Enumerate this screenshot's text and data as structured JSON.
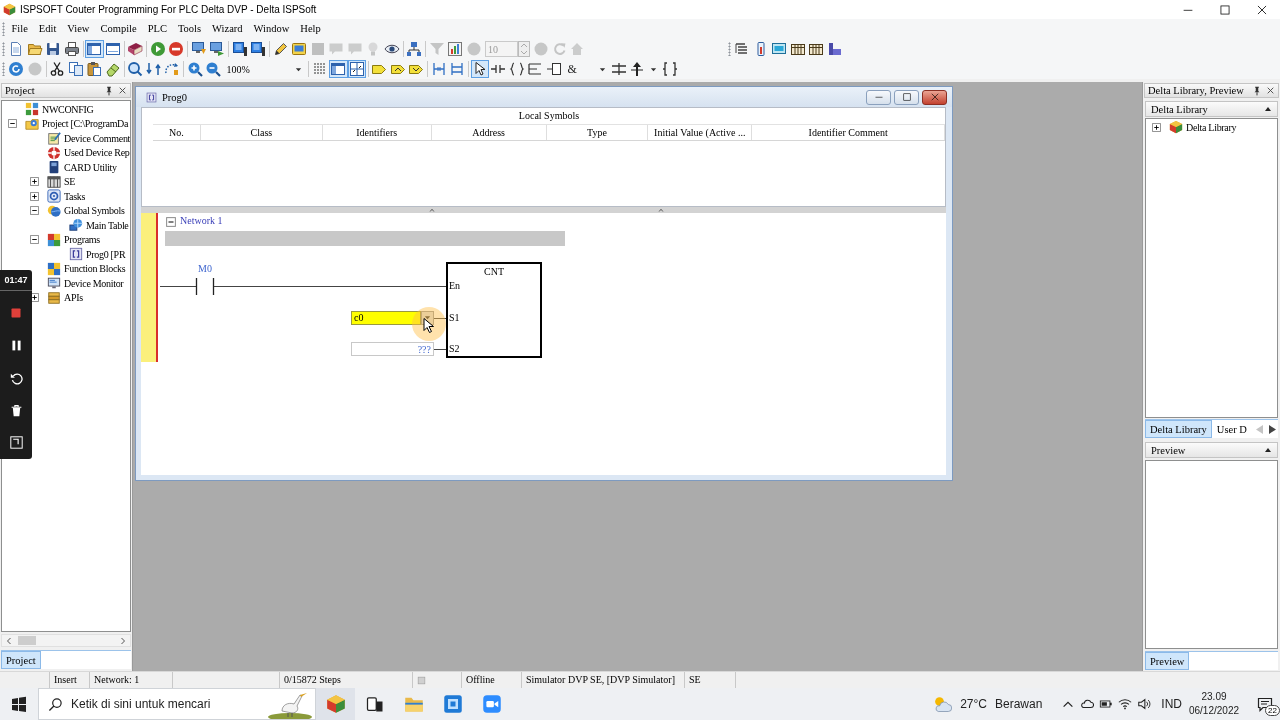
{
  "window": {
    "title": "ISPSOFT Couter Programming For PLC Delta DVP - Delta ISPSoft"
  },
  "menu": [
    "File",
    "Edit",
    "View",
    "Compile",
    "PLC",
    "Tools",
    "Wizard",
    "Window",
    "Help"
  ],
  "toolbar_rows": [
    {
      "toolbars": [
        {
          "items": [
            {
              "kind": "button",
              "disabled": false,
              "pressed": false
            },
            {
              "kind": "button",
              "disabled": false,
              "pressed": false
            },
            {
              "kind": "button",
              "disabled": false,
              "pressed": false
            },
            {
              "kind": "button",
              "disabled": false,
              "pressed": false
            },
            {
              "kind": "separator"
            },
            {
              "kind": "button",
              "disabled": false,
              "pressed": true
            },
            {
              "kind": "button",
              "disabled": false,
              "pressed": false
            },
            {
              "kind": "separator"
            },
            {
              "kind": "button",
              "disabled": false,
              "pressed": false
            },
            {
              "kind": "separator"
            },
            {
              "kind": "button",
              "disabled": false,
              "pressed": false
            },
            {
              "kind": "button",
              "disabled": false,
              "pressed": false
            },
            {
              "kind": "separator"
            },
            {
              "kind": "button",
              "disabled": false,
              "pressed": false
            },
            {
              "kind": "button",
              "disabled": false,
              "pressed": false
            },
            {
              "kind": "separator"
            },
            {
              "kind": "button",
              "disabled": false,
              "pressed": false
            },
            {
              "kind": "button",
              "disabled": false,
              "pressed": false
            },
            {
              "kind": "separator"
            },
            {
              "kind": "button",
              "disabled": false,
              "pressed": false
            },
            {
              "kind": "button",
              "disabled": false,
              "pressed": false
            },
            {
              "kind": "button",
              "disabled": true,
              "pressed": false
            },
            {
              "kind": "button",
              "disabled": true,
              "pressed": false
            },
            {
              "kind": "button",
              "disabled": true,
              "pressed": false
            },
            {
              "kind": "button",
              "disabled": true,
              "pressed": false
            },
            {
              "kind": "button",
              "disabled": false,
              "pressed": false
            },
            {
              "kind": "separator"
            },
            {
              "kind": "button",
              "disabled": false,
              "pressed": false
            },
            {
              "kind": "separator"
            },
            {
              "kind": "button",
              "disabled": true,
              "pressed": false
            },
            {
              "kind": "button",
              "disabled": false,
              "pressed": false
            },
            {
              "kind": "button",
              "disabled": true,
              "pressed": false
            },
            {
              "kind": "spin",
              "value": "10",
              "disabled": true
            },
            {
              "kind": "button",
              "disabled": true,
              "pressed": false
            },
            {
              "kind": "button",
              "disabled": true,
              "pressed": false
            },
            {
              "kind": "button",
              "disabled": true,
              "pressed": false
            }
          ]
        },
        {
          "items": [
            {
              "kind": "button",
              "disabled": false,
              "pressed": false
            },
            {
              "kind": "button",
              "disabled": false,
              "pressed": false
            },
            {
              "kind": "button",
              "disabled": false,
              "pressed": false
            },
            {
              "kind": "button",
              "disabled": false,
              "pressed": false
            },
            {
              "kind": "button",
              "disabled": false,
              "pressed": false
            },
            {
              "kind": "button",
              "disabled": false,
              "pressed": false
            }
          ]
        }
      ]
    },
    {
      "toolbars": [
        {
          "items": [
            {
              "kind": "button",
              "disabled": false,
              "pressed": false
            },
            {
              "kind": "button",
              "disabled": true,
              "pressed": false
            },
            {
              "kind": "separator"
            },
            {
              "kind": "button",
              "disabled": false,
              "pressed": false
            },
            {
              "kind": "button",
              "disabled": false,
              "pressed": false
            },
            {
              "kind": "button",
              "disabled": false,
              "pressed": false
            },
            {
              "kind": "button",
              "disabled": false,
              "pressed": false
            },
            {
              "kind": "separator"
            },
            {
              "kind": "button",
              "disabled": false,
              "pressed": false
            },
            {
              "kind": "button",
              "disabled": false,
              "pressed": false
            },
            {
              "kind": "button",
              "disabled": false,
              "pressed": false
            },
            {
              "kind": "separator"
            },
            {
              "kind": "button",
              "disabled": false,
              "pressed": false
            },
            {
              "kind": "button",
              "disabled": false,
              "pressed": false
            },
            {
              "kind": "combo",
              "value": "100%"
            },
            {
              "kind": "separator"
            },
            {
              "kind": "button",
              "disabled": false,
              "pressed": false
            },
            {
              "kind": "button",
              "disabled": false,
              "pressed": true
            },
            {
              "kind": "button",
              "disabled": false,
              "pressed": true
            },
            {
              "kind": "separator"
            },
            {
              "kind": "button",
              "disabled": false,
              "pressed": false
            },
            {
              "kind": "button",
              "disabled": false,
              "pressed": false
            },
            {
              "kind": "button",
              "disabled": false,
              "pressed": false
            },
            {
              "kind": "separator"
            },
            {
              "kind": "button",
              "disabled": false,
              "pressed": false
            },
            {
              "kind": "button",
              "disabled": false,
              "pressed": false
            },
            {
              "kind": "separator"
            },
            {
              "kind": "button",
              "disabled": false,
              "pressed": true
            },
            {
              "kind": "button",
              "disabled": false,
              "pressed": false
            },
            {
              "kind": "button",
              "disabled": false,
              "pressed": false
            },
            {
              "kind": "button",
              "disabled": false,
              "pressed": false
            },
            {
              "kind": "button",
              "disabled": false,
              "pressed": false
            },
            {
              "kind": "text",
              "label": "&"
            },
            {
              "kind": "dropdown"
            },
            {
              "kind": "button",
              "disabled": false,
              "pressed": false
            },
            {
              "kind": "button",
              "disabled": false,
              "pressed": false
            },
            {
              "kind": "dropdown"
            },
            {
              "kind": "button",
              "disabled": false,
              "pressed": false
            }
          ]
        }
      ]
    }
  ],
  "project_panel": {
    "title": "Project",
    "tree": [
      {
        "label": "NWCONFIG"
      },
      {
        "label": "Project [C:\\ProgramDa",
        "expanded": true,
        "children": [
          {
            "label": "Device Comment"
          },
          {
            "label": "Used Device Rep"
          },
          {
            "label": "CARD Utility"
          },
          {
            "label": "SE",
            "expanded": false
          },
          {
            "label": "Tasks",
            "expanded": false
          },
          {
            "label": "Global Symbols",
            "expanded": true,
            "children": [
              {
                "label": "Main Table"
              }
            ]
          },
          {
            "label": "Programs",
            "expanded": true,
            "children": [
              {
                "label": "Prog0 [PR"
              }
            ]
          },
          {
            "label": "Function Blocks"
          },
          {
            "label": "Device Monitor"
          },
          {
            "label": "APIs",
            "expanded": false
          }
        ]
      }
    ],
    "tabs": [
      {
        "label": "Project",
        "selected": true
      }
    ]
  },
  "editor_window": {
    "title": "Prog0",
    "symbols_table": {
      "title": "Local Symbols",
      "columns": [
        "No.",
        "Class",
        "Identifiers",
        "Address",
        "Type",
        "Initial Value (Active ...",
        "Identifier Comment"
      ]
    },
    "networks": [
      {
        "label": "Network 1",
        "expanded": true,
        "selected": true,
        "rung": [
          {
            "kind": "contact",
            "operand": "M0"
          },
          {
            "kind": "block",
            "name": "CNT",
            "pins": [
              {
                "label": "En"
              },
              {
                "label": "S1",
                "value": "c0",
                "editing": true
              },
              {
                "label": "S2",
                "placeholder": "???",
                "editing": false
              }
            ]
          }
        ]
      }
    ]
  },
  "library_panel": {
    "title": "Delta Library, Preview",
    "sections": [
      {
        "title": "Delta Library",
        "expanded": true,
        "tree": [
          {
            "label": "Delta Library",
            "expanded": false
          }
        ],
        "tabs": [
          {
            "label": "Delta Library",
            "selected": true
          },
          {
            "label": "User D",
            "selected": false
          }
        ],
        "tab_scroll": [
          {
            "disabled": true
          },
          {
            "disabled": false
          }
        ]
      },
      {
        "title": "Preview",
        "expanded": true,
        "tabs": [
          {
            "label": "Preview",
            "selected": true
          }
        ]
      }
    ]
  },
  "status_bar": {
    "items": [
      "Insert",
      "Network: 1",
      "0/15872 Steps",
      "Offline",
      "Simulator DVP SE, [DVP Simulator]",
      "SE"
    ]
  },
  "taskbar": {
    "search": {
      "placeholder": "Ketik di sini untuk mencari"
    },
    "apps": [
      {
        "active": true
      },
      {
        "active": false
      },
      {
        "active": false
      },
      {
        "active": false
      },
      {
        "active": false
      }
    ],
    "weather": {
      "temperature": "27°C",
      "condition": "Berawan"
    },
    "language": "IND",
    "time": "23.09",
    "date": "06/12/2022",
    "notification_count": "22"
  },
  "recorder": {
    "elapsed": "01:47"
  }
}
